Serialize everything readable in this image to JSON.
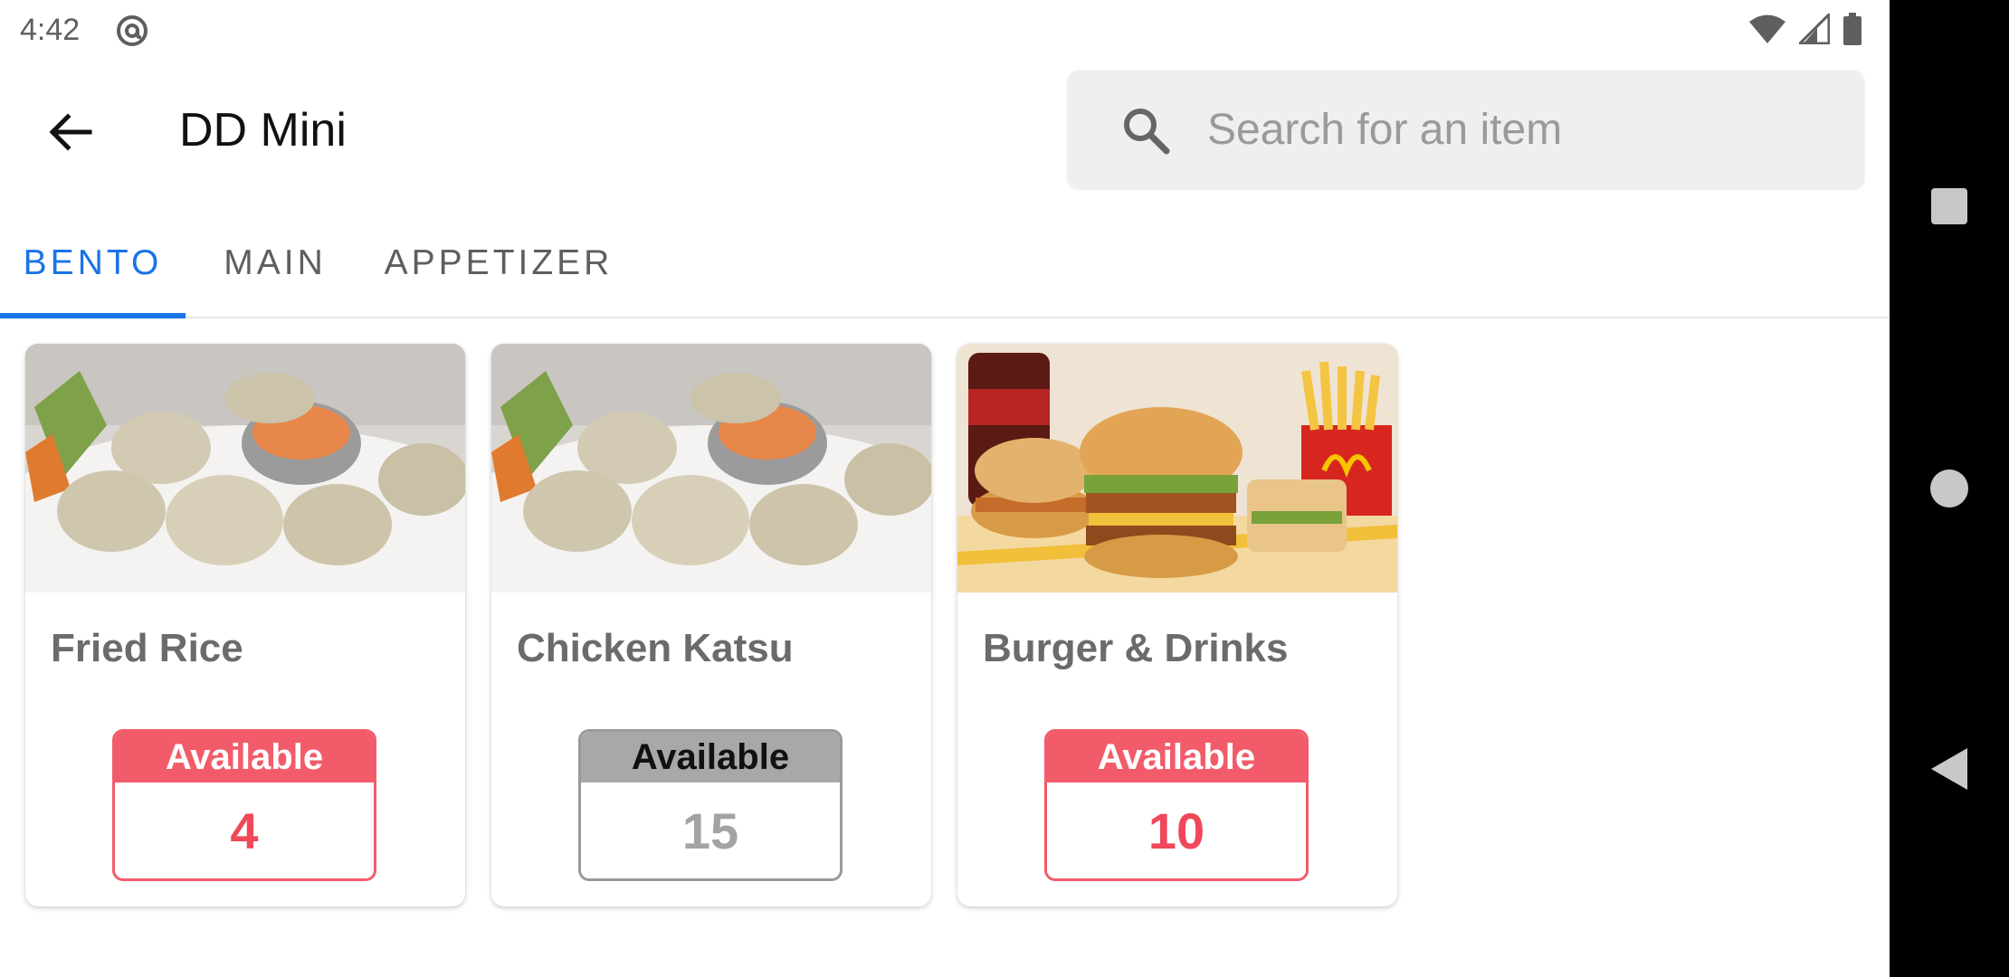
{
  "status_bar": {
    "time": "4:42",
    "icons": [
      "at-sign-icon",
      "wifi-icon",
      "cell-signal-icon",
      "battery-icon"
    ]
  },
  "app_bar": {
    "title": "DD Mini",
    "back_icon": "arrow-back-icon"
  },
  "search": {
    "placeholder": "Search for an item",
    "value": ""
  },
  "tabs": [
    {
      "label": "BENTO",
      "active": true
    },
    {
      "label": "MAIN",
      "active": false
    },
    {
      "label": "APPETIZER",
      "active": false
    }
  ],
  "items": [
    {
      "name": "Fried Rice",
      "status": "Available",
      "count": "4",
      "image": "dumplings-photo",
      "badge_style": "low"
    },
    {
      "name": "Chicken Katsu",
      "status": "Available",
      "count": "15",
      "image": "dumplings-photo",
      "badge_style": "ok"
    },
    {
      "name": "Burger & Drinks",
      "status": "Available",
      "count": "10",
      "image": "burgers-photo",
      "badge_style": "low"
    }
  ],
  "colors": {
    "accent": "#1a73e8",
    "badge_low": "#f25c6a",
    "badge_ok": "#a9a8a8"
  },
  "nav_bar": {
    "icons": [
      "recents-icon",
      "home-icon",
      "back-icon"
    ]
  }
}
